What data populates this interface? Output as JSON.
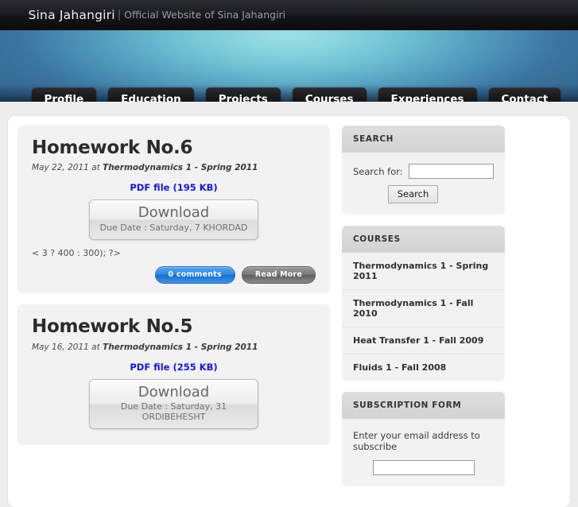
{
  "topbar": {
    "site_title": "Sina Jahangiri",
    "separator": "|",
    "tagline": "Official Website of Sina Jahangiri"
  },
  "nav": {
    "items": [
      {
        "label": "Profile"
      },
      {
        "label": "Education"
      },
      {
        "label": "Projects"
      },
      {
        "label": "Courses"
      },
      {
        "label": "Experiences"
      },
      {
        "label": "Contact"
      }
    ]
  },
  "posts": [
    {
      "title": "Homework No.6",
      "meta_date": "May 22, 2011 at ",
      "meta_category": "Thermodynamics 1 - Spring 2011",
      "pdf_link": "PDF file (195 KB)",
      "download_label": "Download",
      "due_date": "Due Date : Saturday, 7 KHORDAD",
      "snippet": "< 3 ? 400 : 300); ?>",
      "comments_label": "0 comments",
      "readmore_label": "Read More"
    },
    {
      "title": "Homework No.5",
      "meta_date": "May 16, 2011 at ",
      "meta_category": "Thermodynamics 1 - Spring 2011",
      "pdf_link": "PDF file (255 KB)",
      "download_label": "Download",
      "due_date": "Due Date : Saturday, 31 ORDIBEHESHT",
      "snippet": "",
      "comments_label": "",
      "readmore_label": ""
    }
  ],
  "sidebar": {
    "search": {
      "heading": "SEARCH",
      "label": "Search for:",
      "value": "",
      "placeholder": "",
      "button": "Search"
    },
    "courses": {
      "heading": "COURSES",
      "items": [
        {
          "label": "Thermodynamics 1 - Spring 2011"
        },
        {
          "label": "Thermodynamics 1 - Fall 2010"
        },
        {
          "label": "Heat Transfer 1 - Fall 2009"
        },
        {
          "label": "Fluids 1 - Fall 2008"
        }
      ]
    },
    "subscription": {
      "heading": "SUBSCRIPTION FORM",
      "text": "Enter your email address to subscribe",
      "value": "",
      "placeholder": ""
    }
  },
  "colors": {
    "accent_blue": "#2b84e0",
    "link_blue": "#1414ee",
    "banner_center": "#86d3dd",
    "banner_edge": "#33658c",
    "topbar_dark": "#1b1d21"
  }
}
